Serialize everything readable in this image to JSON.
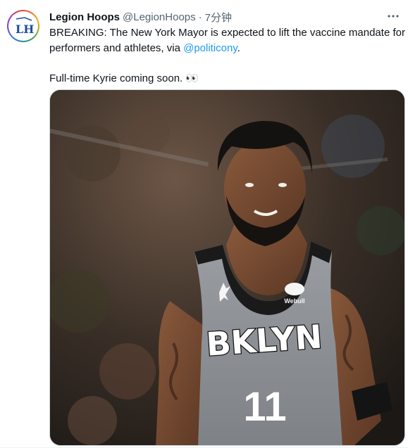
{
  "tweet": {
    "author_name": "Legion Hoops",
    "author_handle": "@LegionHoops",
    "separator": "·",
    "time": "7分钟",
    "avatar_text": "LH",
    "more_icon": "more-horizontal-icon",
    "text_before_link": "BREAKING: The New York Mayor is expected to lift the vaccine mandate for performers and athletes, via ",
    "link_text": "@politicony",
    "text_after_link": ".",
    "second_line": "Full-time Kyrie coming soon. 👀"
  },
  "photo": {
    "jersey_text": "BKLYN",
    "jersey_number": "11",
    "sponsor_text": "Webull"
  },
  "colors": {
    "link": "#1d9bf0",
    "secondary_text": "#536471",
    "jersey_gray": "#8e9297"
  }
}
